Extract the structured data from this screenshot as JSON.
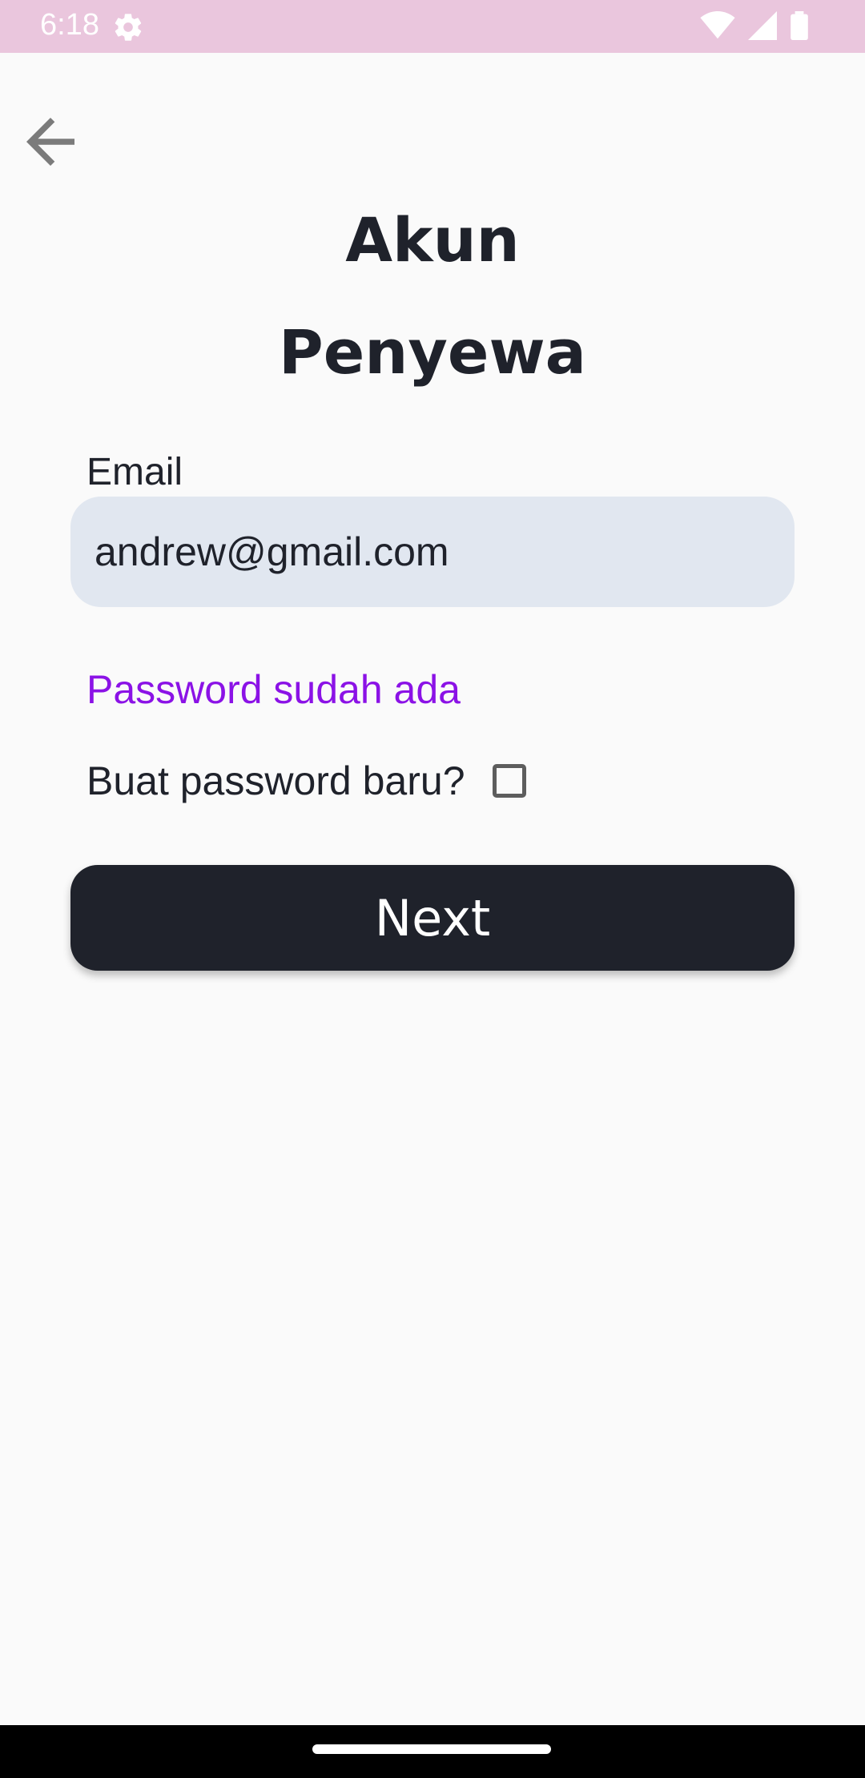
{
  "status_bar": {
    "time": "6:18",
    "icons": [
      "gear-icon",
      "wifi-icon",
      "signal-icon",
      "battery-icon"
    ]
  },
  "header": {
    "back_icon": "arrow-left-icon",
    "title_line1": "Akun",
    "title_line2": "Penyewa"
  },
  "form": {
    "email_label": "Email",
    "email_value": "andrew@gmail.com",
    "password_exists_text": "Password sudah ada",
    "new_password_label": "Buat password baru?",
    "new_password_checked": false,
    "next_label": "Next"
  },
  "colors": {
    "status_bar": "#eac6dd",
    "primary_dark": "#1f222b",
    "input_bg": "#e1e7f0",
    "accent_purple": "#8b12e6",
    "background": "#fafafa"
  }
}
